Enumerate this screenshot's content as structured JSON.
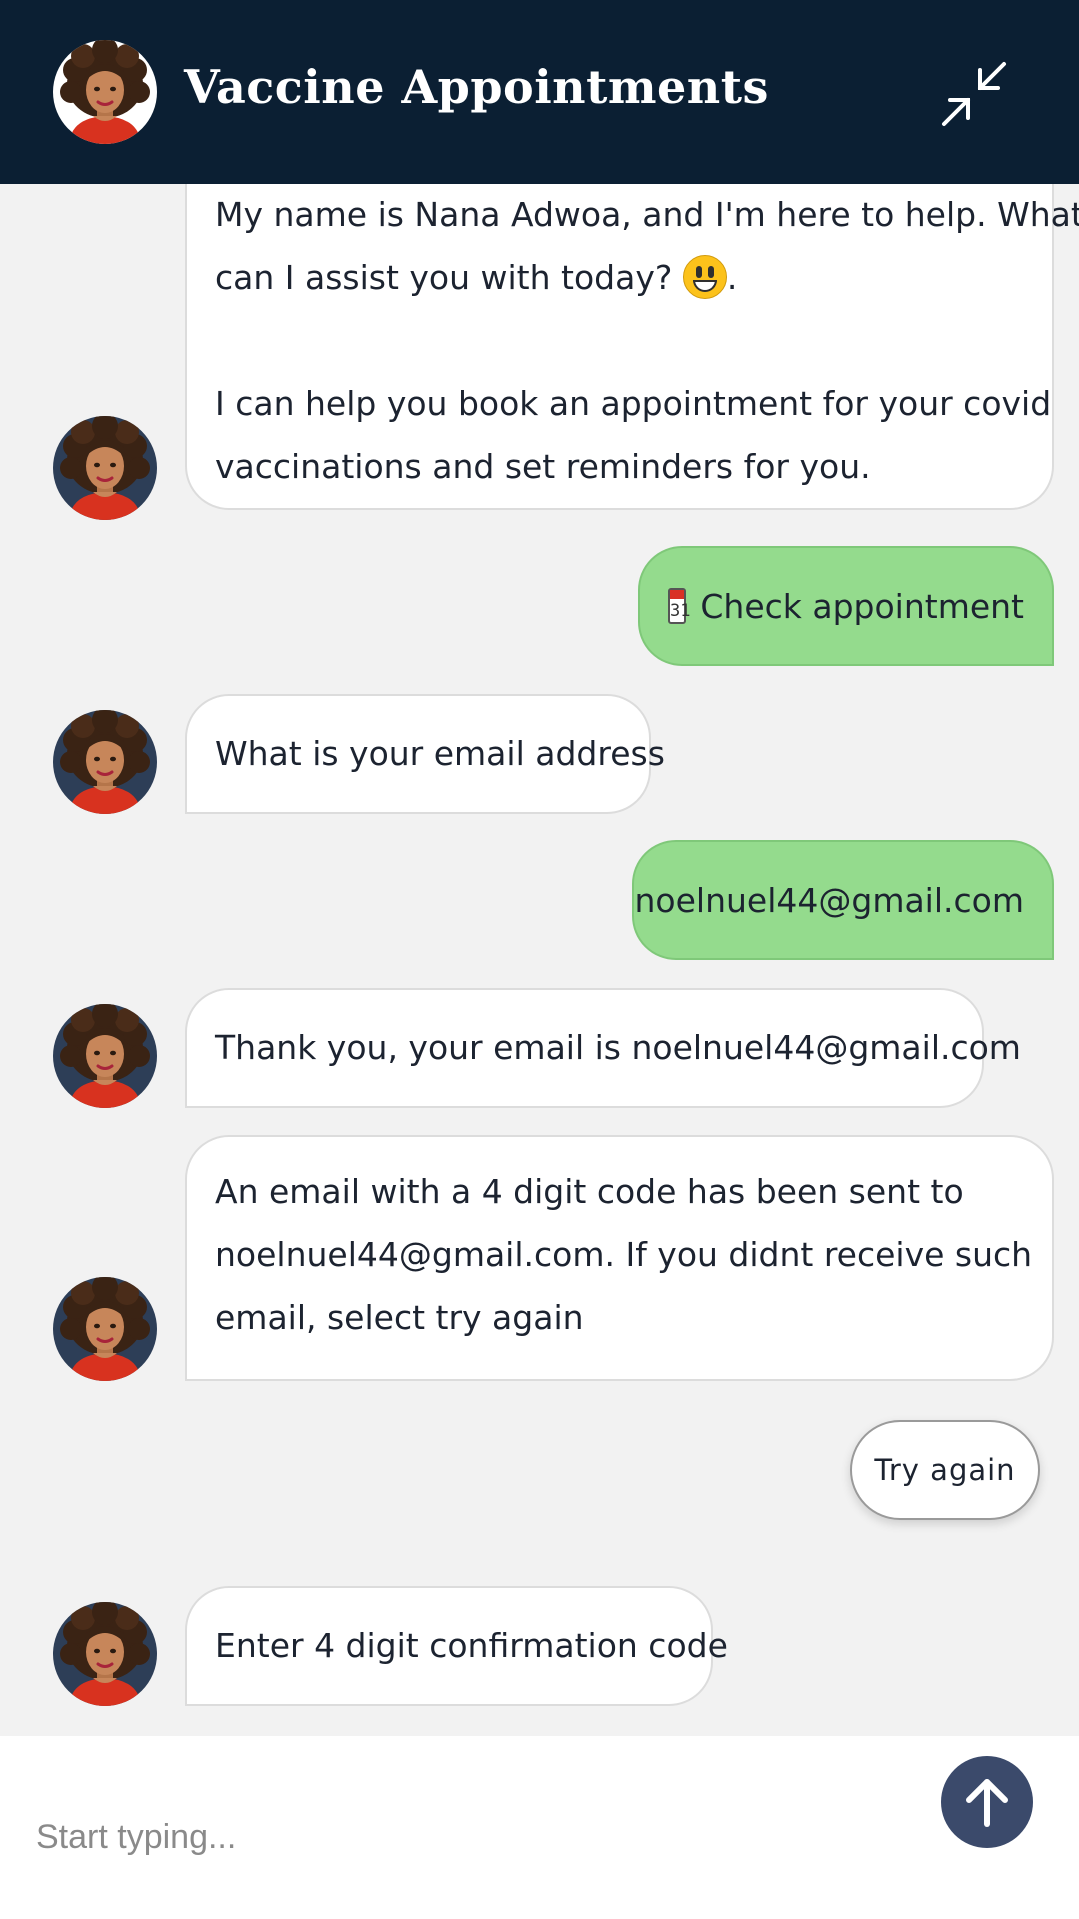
{
  "header": {
    "title": "Vaccine Appointments",
    "minimize_icon": "minimize-arrows-icon",
    "avatar_icon": "agent-avatar"
  },
  "messages": [
    {
      "from": "bot",
      "lines": [
        "My name is Nana Adwoa, and I'm here to help. What",
        "can I assist you with today?",
        "",
        "I can help you book an appointment for your covid",
        "vaccinations and set reminders for you."
      ],
      "emoji": "grinning-face-emoji",
      "after_emoji": "."
    },
    {
      "from": "user",
      "text": "Check appointment",
      "icon": "calendar-icon",
      "icon_text": "31"
    },
    {
      "from": "bot",
      "text": "What is your email address"
    },
    {
      "from": "user",
      "text": "noelnuel44@gmail.com"
    },
    {
      "from": "bot",
      "text": "Thank you, your email is noelnuel44@gmail.com"
    },
    {
      "from": "bot",
      "lines": [
        "An email with a 4 digit code has been sent to",
        "noelnuel44@gmail.com. If you didnt receive such",
        "email, select try again"
      ]
    },
    {
      "from": "bot",
      "text": "Enter 4 digit confirmation code"
    }
  ],
  "quick_replies": [
    "Try again"
  ],
  "composer": {
    "placeholder": "Start typing...",
    "send_icon": "arrow-up-icon"
  },
  "colors": {
    "header_bg": "#0b1f33",
    "user_bubble": "#94db8d",
    "send_button": "#3b4a6b",
    "chat_bg": "#f2f2f2"
  }
}
